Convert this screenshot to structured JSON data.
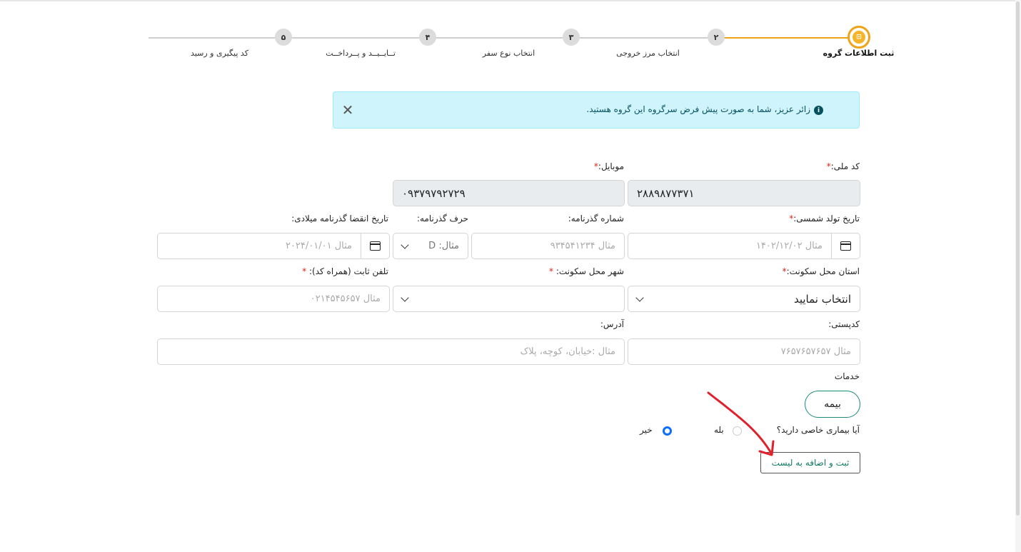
{
  "steps": [
    {
      "num": "۱",
      "label": "ثبت اطلاعات گروه"
    },
    {
      "num": "۲",
      "label": "انتخاب مرز خروجی"
    },
    {
      "num": "۳",
      "label": "انتخاب نوع سفر"
    },
    {
      "num": "۴",
      "label": "تــایــیــد و پــرداخــت"
    },
    {
      "num": "۵",
      "label": "کد پیگیری و رسید"
    }
  ],
  "alert": {
    "message": "زائر عزیز، شما به صورت پیش فرض سرگروه این گروه هستید.",
    "close": "✕",
    "icon": "i"
  },
  "form": {
    "national_code": {
      "label": "کد ملی:",
      "req": "*",
      "value": "۲۸۸۹۸۷۷۳۷۱"
    },
    "mobile": {
      "label": "موبایل:",
      "req": "*",
      "value": "۰۹۳۷۹۷۹۲۷۲۹"
    },
    "birth_date": {
      "label": "تاریخ تولد شمسی:",
      "req": "*",
      "placeholder": "مثال ۱۴۰۲/۱۲/۰۲"
    },
    "passport_number": {
      "label": "شماره گذرنامه:",
      "placeholder": "مثال ۹۳۴۵۴۱۲۳۴"
    },
    "passport_letter": {
      "label": "حرف گذرنامه:",
      "placeholder": "مثال: D"
    },
    "passport_expiry": {
      "label": "تاریخ انقضا گذرنامه میلادی:",
      "placeholder": "مثال ۲۰۲۴/۰۱/۰۱"
    },
    "province": {
      "label": "استان محل سکونت:",
      "req": "*",
      "value": "انتخاب نمایید"
    },
    "city": {
      "label": "شهر محل سکونت:",
      "req": "*",
      "value": ""
    },
    "phone": {
      "label": "تلفن ثابت (همراه کد):",
      "req": "*",
      "placeholder": "مثال ۰۲۱۴۵۴۵۶۵۷"
    },
    "postal_code": {
      "label": "کدپستی:",
      "placeholder": "مثال ۷۶۵۷۶۵۷۶۵۷"
    },
    "address": {
      "label": "آدرس:",
      "placeholder": "مثال :خیابان، کوچه، پلاک"
    },
    "services": {
      "label": "خدمات",
      "insurance": "بیمه"
    },
    "disease": {
      "question": "آیا بیماری خاصی دارید؟",
      "yes": "بله",
      "no": "خیر",
      "selected": "no"
    },
    "submit": "ثبت و اضافه به لیست"
  },
  "colors": {
    "accent": "#f0a318",
    "info_bg": "#cff4fc",
    "teal": "#1b8a78",
    "radio": "#0d6efd",
    "arrow": "#e0202a"
  }
}
